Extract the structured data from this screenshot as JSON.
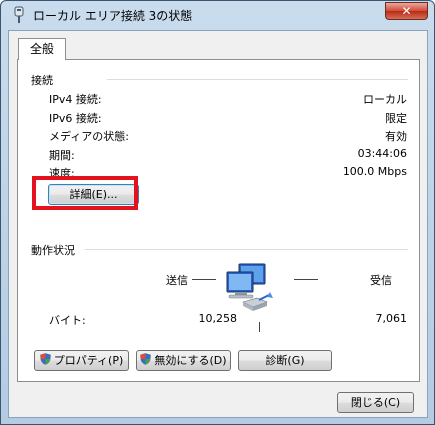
{
  "window": {
    "title": "ローカル エリア接続 3の状態",
    "close_label": "✕"
  },
  "tab": {
    "label": "全般"
  },
  "connection": {
    "heading": "接続",
    "rows": [
      {
        "label": "IPv4 接続:",
        "value": "ローカル"
      },
      {
        "label": "IPv6 接続:",
        "value": "限定"
      },
      {
        "label": "メディアの状態:",
        "value": "有効"
      },
      {
        "label": "期間:",
        "value": "03:44:06"
      },
      {
        "label": "速度:",
        "value": "100.0 Mbps"
      }
    ],
    "details_button": "詳細(E)..."
  },
  "activity": {
    "heading": "動作状況",
    "sent_label": "送信",
    "received_label": "受信",
    "bytes_label": "バイト:",
    "bytes_sent": "10,258",
    "bytes_received": "7,061"
  },
  "actions": {
    "properties_button": "プロパティ(P)",
    "disable_button": "無効にする(D)",
    "diagnose_button": "診断(G)"
  },
  "footer": {
    "close_button": "閉じる(C)"
  },
  "colors": {
    "highlight": "#e4121d",
    "titlebar": "#c9dced"
  },
  "icons": [
    "network-adapter-icon",
    "uac-shield-icon",
    "computers-network-icon"
  ]
}
